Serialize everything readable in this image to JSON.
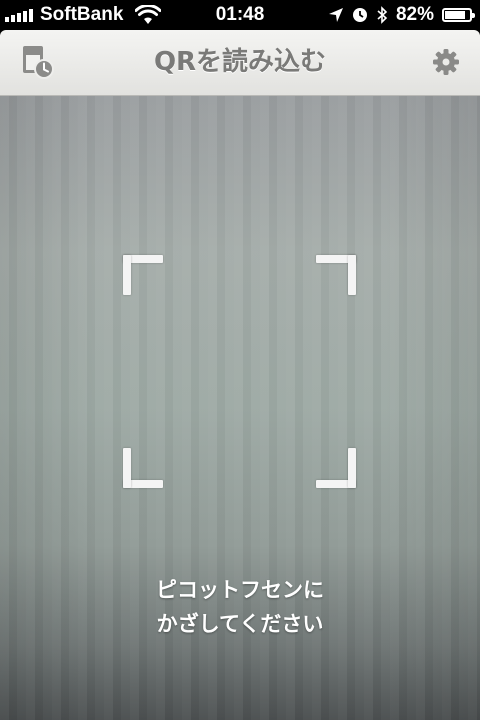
{
  "status_bar": {
    "carrier": "SoftBank",
    "time": "01:48",
    "battery_percent": "82%",
    "battery_level": 0.82
  },
  "nav_bar": {
    "title": "QRを読み込む",
    "left_icon": "history-icon",
    "right_icon": "gear-icon"
  },
  "scanner": {
    "instruction_line1": "ピコットフセンに",
    "instruction_line2": "かざしてください"
  },
  "colors": {
    "nav_title": "#7a7a78",
    "nav_icon": "#8a8a88",
    "frame_corner": "#f4f4f4"
  }
}
